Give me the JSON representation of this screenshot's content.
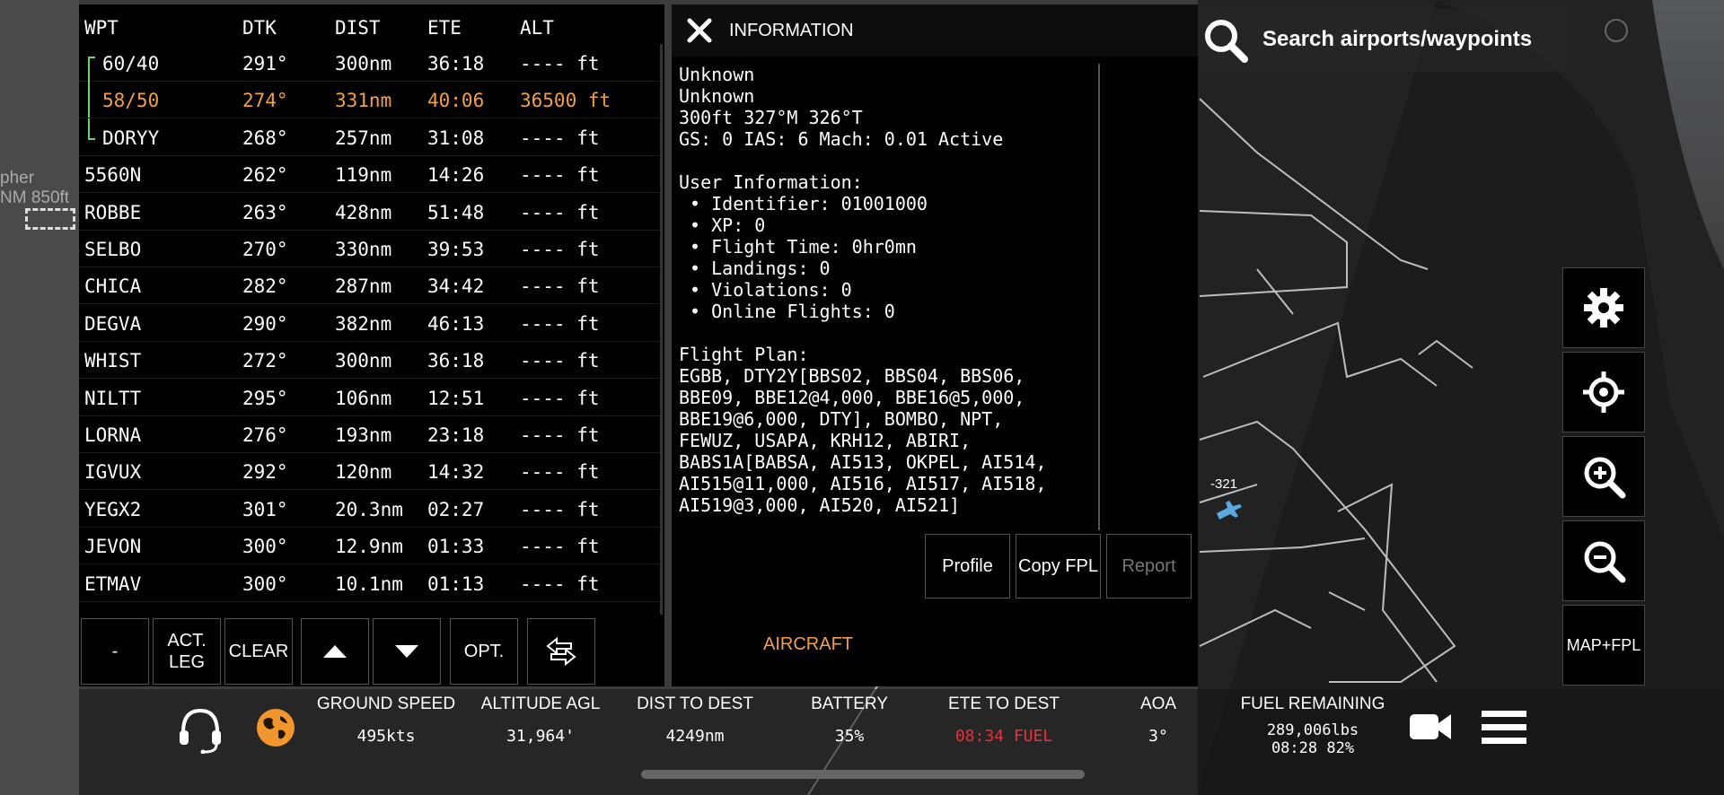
{
  "fpl": {
    "headers": [
      "WPT",
      "DTK",
      "DIST",
      "ETE",
      "ALT"
    ],
    "rows": [
      {
        "wpt": "60/40",
        "dtk": "291°",
        "dist": "300nm",
        "ete": "36:18",
        "alt": "---- ft",
        "active": false,
        "sub": "top"
      },
      {
        "wpt": "58/50",
        "dtk": "274°",
        "dist": "331nm",
        "ete": "40:06",
        "alt": "36500 ft",
        "active": true,
        "sub": "mid"
      },
      {
        "wpt": "DORYY",
        "dtk": "268°",
        "dist": "257nm",
        "ete": "31:08",
        "alt": "---- ft",
        "active": false,
        "sub": "bottom"
      },
      {
        "wpt": "5560N",
        "dtk": "262°",
        "dist": "119nm",
        "ete": "14:26",
        "alt": "---- ft",
        "active": false,
        "sub": ""
      },
      {
        "wpt": "ROBBE",
        "dtk": "263°",
        "dist": "428nm",
        "ete": "51:48",
        "alt": "---- ft",
        "active": false,
        "sub": ""
      },
      {
        "wpt": "SELBO",
        "dtk": "270°",
        "dist": "330nm",
        "ete": "39:53",
        "alt": "---- ft",
        "active": false,
        "sub": ""
      },
      {
        "wpt": "CHICA",
        "dtk": "282°",
        "dist": "287nm",
        "ete": "34:42",
        "alt": "---- ft",
        "active": false,
        "sub": ""
      },
      {
        "wpt": "DEGVA",
        "dtk": "290°",
        "dist": "382nm",
        "ete": "46:13",
        "alt": "---- ft",
        "active": false,
        "sub": ""
      },
      {
        "wpt": "WHIST",
        "dtk": "272°",
        "dist": "300nm",
        "ete": "36:18",
        "alt": "---- ft",
        "active": false,
        "sub": ""
      },
      {
        "wpt": "NILTT",
        "dtk": "295°",
        "dist": "106nm",
        "ete": "12:51",
        "alt": "---- ft",
        "active": false,
        "sub": ""
      },
      {
        "wpt": "LORNA",
        "dtk": "276°",
        "dist": "193nm",
        "ete": "23:18",
        "alt": "---- ft",
        "active": false,
        "sub": ""
      },
      {
        "wpt": "IGVUX",
        "dtk": "292°",
        "dist": "120nm",
        "ete": "14:32",
        "alt": "---- ft",
        "active": false,
        "sub": ""
      },
      {
        "wpt": "YEGX2",
        "dtk": "301°",
        "dist": "20.3nm",
        "ete": "02:27",
        "alt": "---- ft",
        "active": false,
        "sub": ""
      },
      {
        "wpt": "JEVON",
        "dtk": "300°",
        "dist": "12.9nm",
        "ete": "01:33",
        "alt": "---- ft",
        "active": false,
        "sub": ""
      },
      {
        "wpt": "ETMAV",
        "dtk": "300°",
        "dist": "10.1nm",
        "ete": "01:13",
        "alt": "---- ft",
        "active": false,
        "sub": ""
      }
    ],
    "buttons": {
      "minus": "-",
      "act_leg_1": "ACT.",
      "act_leg_2": "LEG",
      "clear": "CLEAR",
      "opt": "OPT."
    }
  },
  "info": {
    "title": "INFORMATION",
    "text": "Unknown\nUnknown\n300ft 327°M 326°T\nGS: 0 IAS: 6 Mach: 0.01 Active\n\nUser Information:\n • Identifier: 01001000\n • XP: 0\n • Flight Time: 0hr0mn\n • Landings: 0\n • Violations: 0\n • Online Flights: 0\n\nFlight Plan:\nEGBB, DTY2Y[BBS02, BBS04, BBS06,\nBBE09, BBE12@4,000, BBE16@5,000,\nBBE19@6,000, DTY], BOMBO, NPT,\nFEWUZ, USAPA, KRH12, ABIRI,\nBABS1A[BABSA, AI513, OKPEL, AI514,\nAI515@11,000, AI516, AI517, AI518,\nAI519@3,000, AI520, AI521]",
    "buttons": {
      "profile": "Profile",
      "copy_fpl": "Copy FPL",
      "report": "Report"
    },
    "aircraft_tab": "AIRCRAFT"
  },
  "search": {
    "placeholder": "Search airports/waypoints"
  },
  "map": {
    "label_321": "-321",
    "map_fpl": "MAP+FPL"
  },
  "left_edge": {
    "line1": "pher",
    "line2": "NM 850ft"
  },
  "status": {
    "ground_speed": {
      "label": "GROUND SPEED",
      "value": "495kts"
    },
    "altitude_agl": {
      "label": "ALTITUDE AGL",
      "value": "31,964'"
    },
    "dist_to_dest": {
      "label": "DIST TO DEST",
      "value": "4249nm"
    },
    "battery": {
      "label": "BATTERY",
      "value": "35%"
    },
    "ete_to_dest": {
      "label": "ETE TO DEST",
      "value": "08:34 FUEL"
    },
    "aoa": {
      "label": "AOA",
      "value": "3°"
    },
    "fuel_remaining": {
      "label": "FUEL REMAINING",
      "value1": "289,006lbs",
      "value2": "08:28 82%"
    }
  },
  "colors": {
    "active": "#f0a04b",
    "route_line": "#6fd07a",
    "alert": "#e8323a",
    "plane": "#5aa8e0"
  },
  "icons": [
    "close-icon",
    "search-icon",
    "gear-icon",
    "crosshair-icon",
    "zoom-in-icon",
    "zoom-out-icon",
    "headset-icon",
    "globe-icon",
    "camera-icon",
    "menu-icon",
    "arrow-up-icon",
    "arrow-down-icon",
    "swap-icon",
    "plane-icon"
  ]
}
